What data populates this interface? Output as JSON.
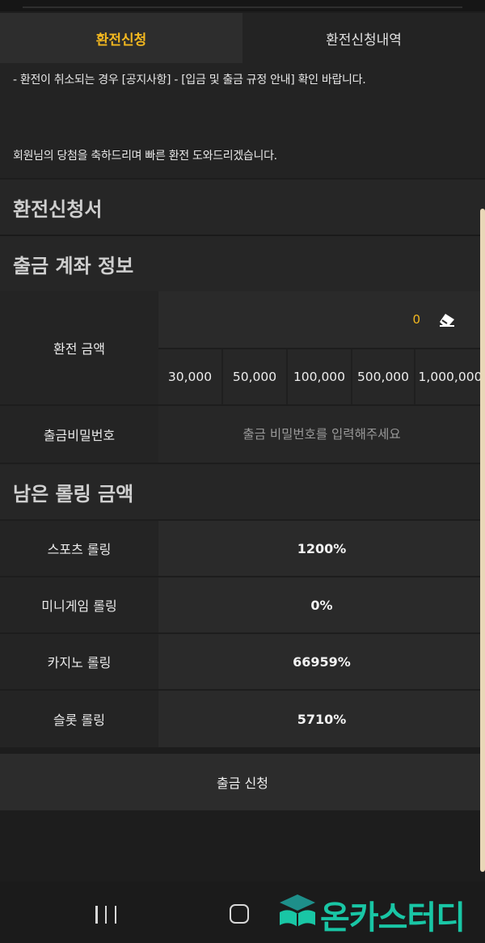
{
  "tabs": [
    {
      "label": "환전신청",
      "active": true
    },
    {
      "label": "환전신청내역",
      "active": false
    }
  ],
  "notice": {
    "line1": "- 환전이 취소되는 경우 [공지사항] - [입금 및 출금 규정 안내] 확인 바랍니다.",
    "line2": "회원님의 당첨을 축하드리며 빠른 환전 도와드리겠습니다."
  },
  "form_title": "환전신청서",
  "account_section": {
    "title": "출금 계좌 정보",
    "amount_label": "환전 금액",
    "amount_value": "0",
    "eraser_icon": "eraser-icon",
    "quick_amounts": [
      "30,000",
      "50,000",
      "100,000",
      "500,000",
      "1,000,000"
    ],
    "password_label": "출금비밀번호",
    "password_placeholder": "출금 비밀번호를 입력해주세요"
  },
  "rolling_section": {
    "title": "남은 롤링 금액",
    "rows": [
      {
        "label": "스포츠 롤링",
        "value": "1200%"
      },
      {
        "label": "미니게임 롤링",
        "value": "0%"
      },
      {
        "label": "카지노 롤링",
        "value": "66959%"
      },
      {
        "label": "슬롯 롤링",
        "value": "5710%"
      }
    ]
  },
  "submit_label": "출금 신청",
  "nav": {
    "recent_icon": "recent-apps-icon",
    "home_icon": "home-icon"
  },
  "watermark": {
    "text": "온카스터디",
    "icon": "book-cap-logo-icon"
  },
  "colors": {
    "accent": "#f3b81f",
    "background": "#1d1d1d",
    "watermark": "#19c6a5"
  }
}
